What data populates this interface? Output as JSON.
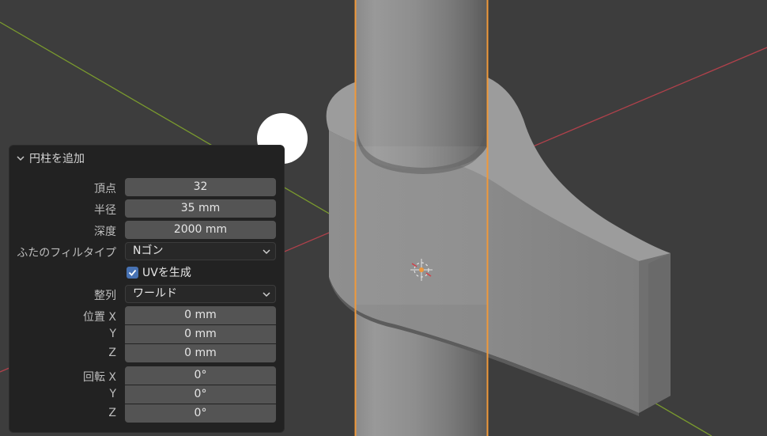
{
  "panel": {
    "title": "円柱を追加",
    "vertices_label": "頂点",
    "vertices_value": "32",
    "radius_label": "半径",
    "radius_value": "35 mm",
    "depth_label": "深度",
    "depth_value": "2000 mm",
    "cap_fill_label": "ふたのフィルタイプ",
    "cap_fill_value": "Nゴン",
    "uv_label": "UVを生成",
    "uv_checked": true,
    "align_label": "整列",
    "align_value": "ワールド",
    "location_label": "位置 X",
    "location_y_label": "Y",
    "location_z_label": "Z",
    "location_x": "0 mm",
    "location_y": "0 mm",
    "location_z": "0 mm",
    "rotation_label": "回転 X",
    "rotation_y_label": "Y",
    "rotation_z_label": "Z",
    "rotation_x": "0°",
    "rotation_y": "0°",
    "rotation_z": "0°"
  },
  "colors": {
    "viewport_bg": "#3d3d3d",
    "x_axis": "#b0414b",
    "y_axis": "#7a9a2e",
    "selection_outline": "#f0993a",
    "checkbox_accent": "#4772b3"
  },
  "icons": {
    "collapse": "chevron-down-icon",
    "dropdown": "chevron-down-icon",
    "check": "checkmark-icon",
    "origin": "object-origin-icon"
  }
}
